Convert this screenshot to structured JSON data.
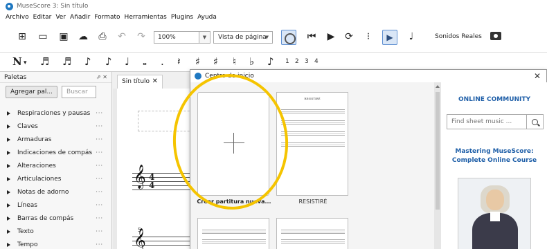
{
  "window": {
    "title": "MuseScore 3: Sin título"
  },
  "menu": [
    "Archivo",
    "Editar",
    "Ver",
    "Añadir",
    "Formato",
    "Herramientas",
    "Plugins",
    "Ayuda"
  ],
  "toolbar": {
    "zoom_value": "100%",
    "view_mode": "Vista de página",
    "real_sounds": "Sonidos Reales"
  },
  "voice_numbers": [
    "1",
    "2",
    "3",
    "4"
  ],
  "palettes": {
    "title": "Paletas",
    "add_button": "Agregar pal...",
    "search_button": "Buscar",
    "more_glyph": "···",
    "items": [
      "Respiraciones y pausas",
      "Claves",
      "Armaduras",
      "Indicaciones de compás",
      "Alteraciones",
      "Articulaciones",
      "Notas de adorno",
      "Líneas",
      "Barras de compás",
      "Texto",
      "Tempo"
    ]
  },
  "score": {
    "tab_label": "Sin título",
    "time_sig_top": "4",
    "time_sig_bottom": "4",
    "measure_number": "5"
  },
  "start_center": {
    "title": "Centro de inicio",
    "new_score_label": "Crear partitura nueva...",
    "recent_score_label": "RESISTIRÉ",
    "online_community_title": "ONLINE COMMUNITY",
    "find_placeholder": "Find sheet music ...",
    "course_title": "Mastering MuseScore: Complete Online Course"
  },
  "colors": {
    "accent_blue": "#1f5fa8",
    "highlight_yellow": "#f5c400"
  }
}
